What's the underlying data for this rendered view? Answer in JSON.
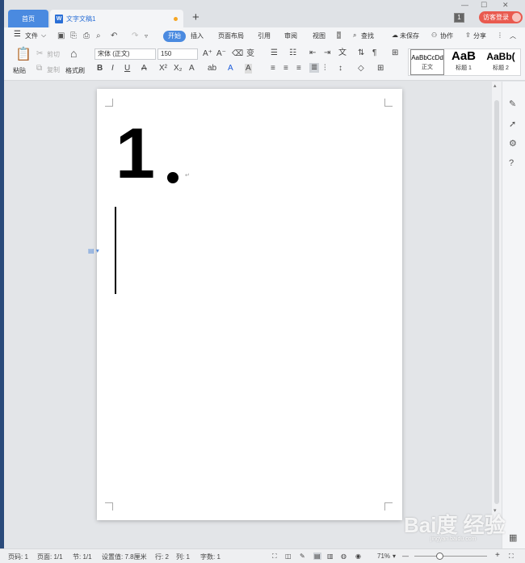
{
  "tabs": {
    "home": "首页",
    "doc": "文字文稿1",
    "doc_icon": "W",
    "add": "+"
  },
  "window": {
    "minimize": "—",
    "maximize": "☐",
    "close": "✕",
    "badge": "1",
    "login": "访客登录"
  },
  "menu": {
    "file": "文件",
    "items": [
      "开始",
      "插入",
      "页面布局",
      "引用",
      "审阅",
      "视图"
    ],
    "search": "查找",
    "unsaved": "未保存",
    "collab": "协作",
    "share": "分享"
  },
  "ribbon": {
    "paste": "粘贴",
    "cut": "剪切",
    "copy": "复制",
    "format_painter": "格式刷",
    "font_name": "宋体 (正文)",
    "font_size": "150",
    "bold": "B",
    "italic": "I",
    "underline": "U"
  },
  "styles": [
    {
      "preview": "AaBbCcDd",
      "name": "正文"
    },
    {
      "preview": "AaB",
      "name": "标题 1"
    },
    {
      "preview": "AaBb(",
      "name": "标题 2"
    }
  ],
  "document": {
    "number_text": "1",
    "paragraph_mark": "↵"
  },
  "status": {
    "page_num": "页码: 1",
    "pages": "页面: 1/1",
    "section": "节: 1/1",
    "position": "设置值: 7.8厘米",
    "row": "行: 2",
    "col": "列: 1",
    "words": "字数: 1",
    "zoom": "71%"
  },
  "watermark": {
    "main": "Bai度 经验",
    "sub": "jingyan.baidu.com"
  },
  "colors": {
    "accent": "#4a8ae0",
    "login": "#e95a4f",
    "unsaved_dot": "#f5a623"
  }
}
